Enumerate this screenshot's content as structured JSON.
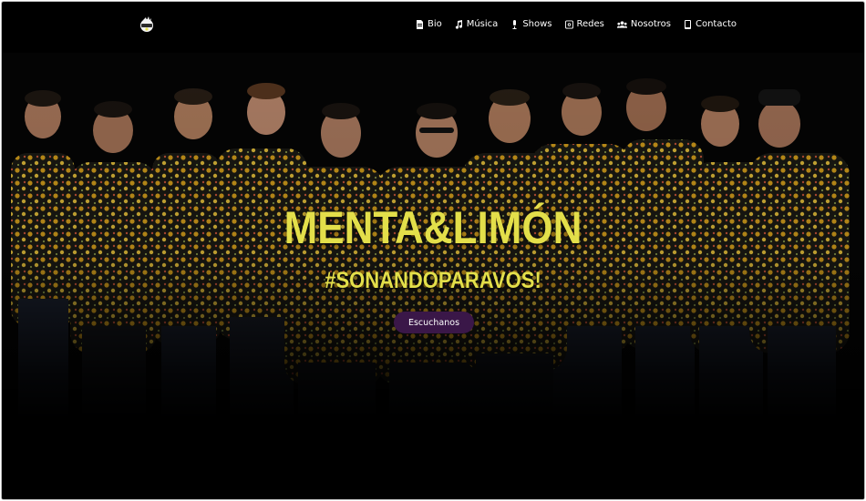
{
  "brand": {
    "logo_icon": "band-logo-icon"
  },
  "nav": {
    "items": [
      {
        "label": "Bio",
        "icon": "document-icon"
      },
      {
        "label": "Música",
        "icon": "music-note-icon"
      },
      {
        "label": "Shows",
        "icon": "microphone-icon"
      },
      {
        "label": "Redes",
        "icon": "instagram-icon"
      },
      {
        "label": "Nosotros",
        "icon": "users-icon"
      },
      {
        "label": "Contacto",
        "icon": "phone-icon"
      }
    ]
  },
  "hero": {
    "title": "MENTA&LIMÓN",
    "subtitle": "#SONANDOPARAVOS!",
    "cta_label": "Escuchanos"
  },
  "colors": {
    "background": "#000000",
    "accent_yellow": "#e3df4a",
    "button_purple": "#3a1748",
    "nav_text": "#ffffff"
  }
}
